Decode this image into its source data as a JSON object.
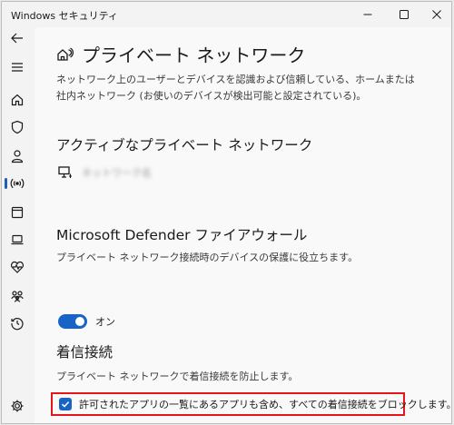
{
  "window": {
    "title": "Windows セキュリティ"
  },
  "nav": {
    "items": [
      {
        "icon": "back-arrow-icon"
      },
      {
        "icon": "hamburger-menu-icon"
      },
      {
        "icon": "home-icon"
      },
      {
        "icon": "shield-icon"
      },
      {
        "icon": "person-icon"
      },
      {
        "icon": "wireless-icon",
        "selected": true
      },
      {
        "icon": "app-browser-icon"
      },
      {
        "icon": "laptop-icon"
      },
      {
        "icon": "health-icon"
      },
      {
        "icon": "family-icon"
      },
      {
        "icon": "history-icon"
      },
      {
        "icon": "gear-icon"
      }
    ]
  },
  "page": {
    "icon": "private-network-icon",
    "title": "プライベート ネットワーク",
    "description": "ネットワーク上のユーザーとデバイスを認識および信頼している、ホームまたは社内ネットワーク (お使いのデバイスが検出可能と設定されている)。"
  },
  "active_networks": {
    "heading": "アクティブなプライベート ネットワーク",
    "network_name": "ネットワーク名",
    "icon": "monitor-network-icon"
  },
  "firewall": {
    "heading": "Microsoft Defender ファイアウォール",
    "description": "プライベート ネットワーク接続時のデバイスの保護に役立ちます。",
    "toggle_label": "オン",
    "toggle_on": true
  },
  "incoming": {
    "heading": "着信接続",
    "description": "プライベート ネットワークで着信接続を防止します。",
    "checkbox_label": "許可されたアプリの一覧にあるアプリも含め、すべての着信接続をブロックします。",
    "checked": true
  },
  "colors": {
    "accent": "#1a63c6",
    "highlight": "#e8141c",
    "nav_indicator": "#1f5fb8"
  }
}
